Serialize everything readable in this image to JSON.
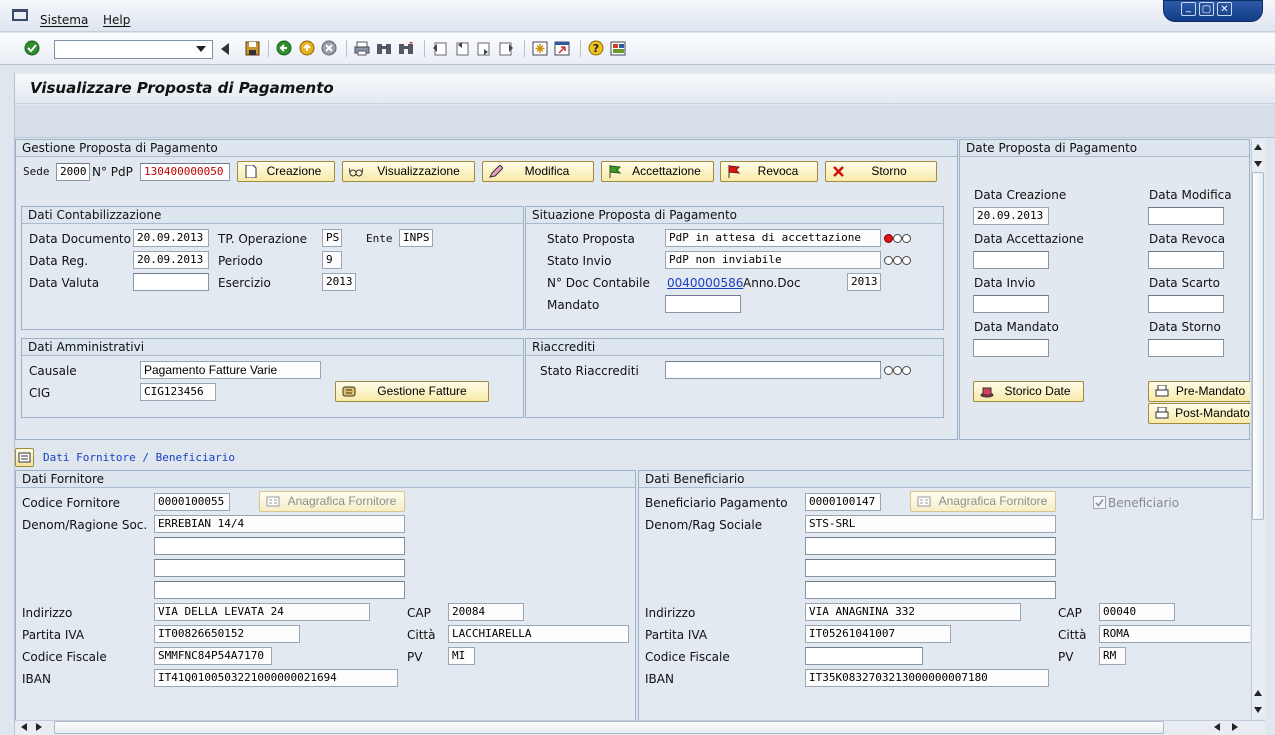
{
  "menu": {
    "sistema": "Sistema",
    "help": "Help"
  },
  "window_controls": {
    "minimize": "_",
    "restore": "▢",
    "close": "✕"
  },
  "toolbar": {
    "command_field_value": ""
  },
  "page": {
    "title": "Visualizzare Proposta di Pagamento"
  },
  "gestione": {
    "title": "Gestione Proposta di Pagamento",
    "sede_label": "Sede",
    "sede_value": "2000",
    "pdp_label": "N° PdP",
    "pdp_value": "130400000050",
    "buttons": {
      "creazione": "Creazione",
      "visualizzazione": "Visualizzazione",
      "modifica": "Modifica",
      "accettazione": "Accettazione",
      "revoca": "Revoca",
      "storno": "Storno"
    }
  },
  "contabilizzazione": {
    "title": "Dati Contabilizzazione",
    "data_documento_label": "Data Documento",
    "data_documento": "20.09.2013",
    "data_reg_label": "Data Reg.",
    "data_reg": "20.09.2013",
    "data_valuta_label": "Data Valuta",
    "data_valuta": "",
    "tp_operazione_label": "TP. Operazione",
    "tp_operazione": "PS",
    "periodo_label": "Periodo",
    "periodo": "9",
    "esercizio_label": "Esercizio",
    "esercizio": "2013",
    "ente_label": "Ente",
    "ente": "INPS"
  },
  "situazione": {
    "title": "Situazione Proposta di Pagamento",
    "stato_proposta_label": "Stato Proposta",
    "stato_proposta": "PdP in attesa di accettazione",
    "stato_invio_label": "Stato Invio",
    "stato_invio": "PdP non inviabile",
    "doc_contabile_label": "N° Doc Contabile",
    "doc_contabile": "0040000586",
    "anno_doc_label": "Anno.Doc",
    "anno_doc": "2013",
    "mandato_label": "Mandato",
    "mandato": ""
  },
  "amministrativi": {
    "title": "Dati Amministrativi",
    "causale_label": "Causale",
    "causale": "Pagamento Fatture Varie",
    "cig_label": "CIG",
    "cig": "CIG123456",
    "gestione_fatture": "Gestione Fatture"
  },
  "riaccrediti": {
    "title": "Riaccrediti",
    "stato_label": "Stato Riaccrediti",
    "stato": ""
  },
  "date_pdp": {
    "title": "Date Proposta di Pagamento",
    "data_creazione_label": "Data Creazione",
    "data_creazione": "20.09.2013",
    "data_modifica_label": "Data Modifica",
    "data_modifica": "",
    "data_accettazione_label": "Data Accettazione",
    "data_accettazione": "",
    "data_revoca_label": "Data Revoca",
    "data_revoca": "",
    "data_invio_label": "Data Invio",
    "data_invio": "",
    "data_scarto_label": "Data Scarto",
    "data_scarto": "",
    "data_mandato_label": "Data Mandato",
    "data_mandato": "",
    "data_storno_label": "Data Storno",
    "data_storno": "",
    "storico_date": "Storico Date",
    "pre_mandato": "Pre-Mandato",
    "post_mandato": "Post-Mandato"
  },
  "fornitore_header": {
    "label": "Dati Fornitore / Beneficiario"
  },
  "fornitore": {
    "title": "Dati Fornitore",
    "codice_label": "Codice Fornitore",
    "codice": "0000100055",
    "anagrafica_btn": "Anagrafica Fornitore",
    "denom_label": "Denom/Ragione Soc.",
    "denom_lines": [
      "ERREBIAN 14/4",
      "",
      "",
      ""
    ],
    "indirizzo_label": "Indirizzo",
    "indirizzo": "VIA DELLA LEVATA 24",
    "cap_label": "CAP",
    "cap": "20084",
    "piva_label": "Partita IVA",
    "piva": "IT00826650152",
    "citta_label": "Città",
    "citta": "LACCHIARELLA",
    "cf_label": "Codice Fiscale",
    "cf": "SMMFNC84P54A7170",
    "pv_label": "PV",
    "pv": "MI",
    "iban_label": "IBAN",
    "iban": "IT41Q0100503221000000021694"
  },
  "beneficiario": {
    "title": "Dati Beneficiario",
    "codice_label": "Beneficiario Pagamento",
    "codice": "0000100147",
    "anagrafica_btn": "Anagrafica Fornitore",
    "checkbox_label": "Beneficiario",
    "checkbox_checked": true,
    "denom_label": "Denom/Rag Sociale",
    "denom_lines": [
      "STS-SRL",
      "",
      "",
      ""
    ],
    "indirizzo_label": "Indirizzo",
    "indirizzo": "VIA ANAGNINA 332",
    "cap_label": "CAP",
    "cap": "00040",
    "piva_label": "Partita IVA",
    "piva": "IT05261041007",
    "citta_label": "Città",
    "citta": "ROMA",
    "cf_label": "Codice Fiscale",
    "cf": "",
    "pv_label": "PV",
    "pv": "RM",
    "iban_label": "IBAN",
    "iban": "IT35K0832703213000000007180"
  },
  "colors": {
    "accent": "#f7eaa8",
    "link": "#1a3fc2",
    "red_light": "#e81010"
  },
  "icons": [
    "check-icon",
    "back-icon",
    "save-icon",
    "nav-back-icon",
    "exit-icon",
    "cancel-icon",
    "print-icon",
    "find-icon",
    "find-next-icon",
    "first-page-icon",
    "prev-page-icon",
    "next-page-icon",
    "last-page-icon",
    "new-session-icon",
    "shortcut-icon",
    "help-icon",
    "customize-icon"
  ]
}
